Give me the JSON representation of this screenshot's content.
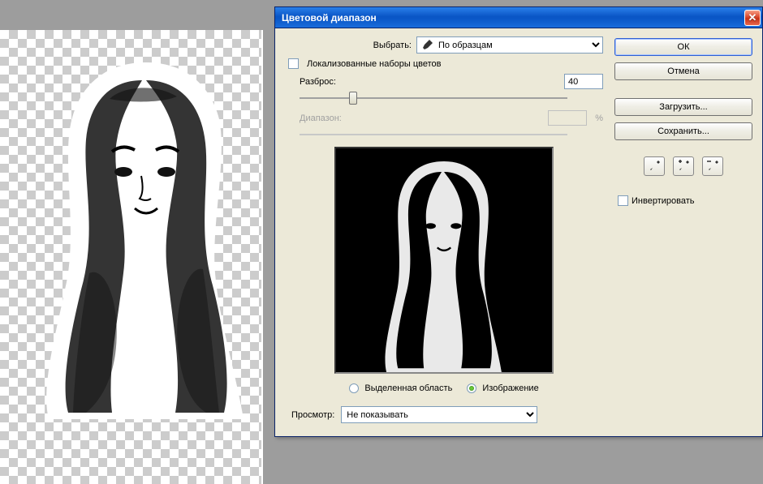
{
  "dialog": {
    "title": "Цветовой диапазон",
    "select_label": "Выбрать:",
    "select_value": "По образцам",
    "localized_sets": "Локализованные наборы цветов",
    "fuzziness_label": "Разброс:",
    "fuzziness_value": "40",
    "range_label": "Диапазон:",
    "range_unit": "%",
    "radio_selection": "Выделенная область",
    "radio_image": "Изображение",
    "preview_label": "Просмотр:",
    "preview_value": "Не показывать"
  },
  "buttons": {
    "ok": "ОК",
    "cancel": "Отмена",
    "load": "Загрузить...",
    "save": "Сохранить..."
  },
  "invert": "Инвертировать",
  "slider_percent": 20
}
